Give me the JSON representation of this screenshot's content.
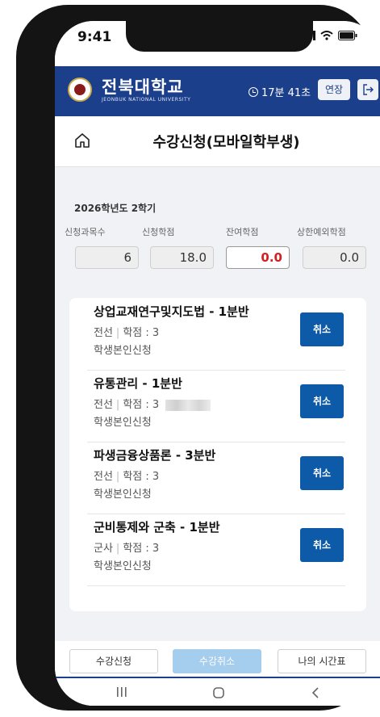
{
  "status_bar": {
    "time": "9:41"
  },
  "header": {
    "university_name": "전북대학교",
    "university_name_en": "JEONBUK NATIONAL UNIVERSITY",
    "timer": "17분 41초",
    "extend_label": "연장"
  },
  "page": {
    "title": "수강신청(모바일학부생)"
  },
  "summary": {
    "semester": "2026학년도 2학기",
    "stats": [
      {
        "label": "신청과목수",
        "value": "6"
      },
      {
        "label": "신청학점",
        "value": "18.0"
      },
      {
        "label": "잔여학점",
        "value": "0.0"
      },
      {
        "label": "상한예외학점",
        "value": "0.0"
      }
    ]
  },
  "courses": [
    {
      "name": "상업교재연구및지도법 - 1분반",
      "type": "전선",
      "credit": "학점 : 3",
      "status": "학생본인신청",
      "button": "취소"
    },
    {
      "name": "유통관리 - 1분반",
      "type": "전선",
      "credit": "학점 : 3",
      "status": "학생본인신청",
      "button": "취소"
    },
    {
      "name": "파생금융상품론 - 3분반",
      "type": "전선",
      "credit": "학점 : 3",
      "status": "학생본인신청",
      "button": "취소"
    },
    {
      "name": "군비통제와 군축 - 1분반",
      "type": "군사",
      "credit": "학점 : 3",
      "status": "학생본인신청",
      "button": "취소"
    }
  ],
  "tabs": [
    {
      "label": "수강신청",
      "active": false
    },
    {
      "label": "수강취소",
      "active": true
    },
    {
      "label": "나의 시간표",
      "active": false
    }
  ],
  "colors": {
    "brand_blue": "#1c3f8c",
    "button_blue": "#0d5aa8",
    "active_tab": "#a5cdee",
    "remaining_red": "#d42020"
  }
}
